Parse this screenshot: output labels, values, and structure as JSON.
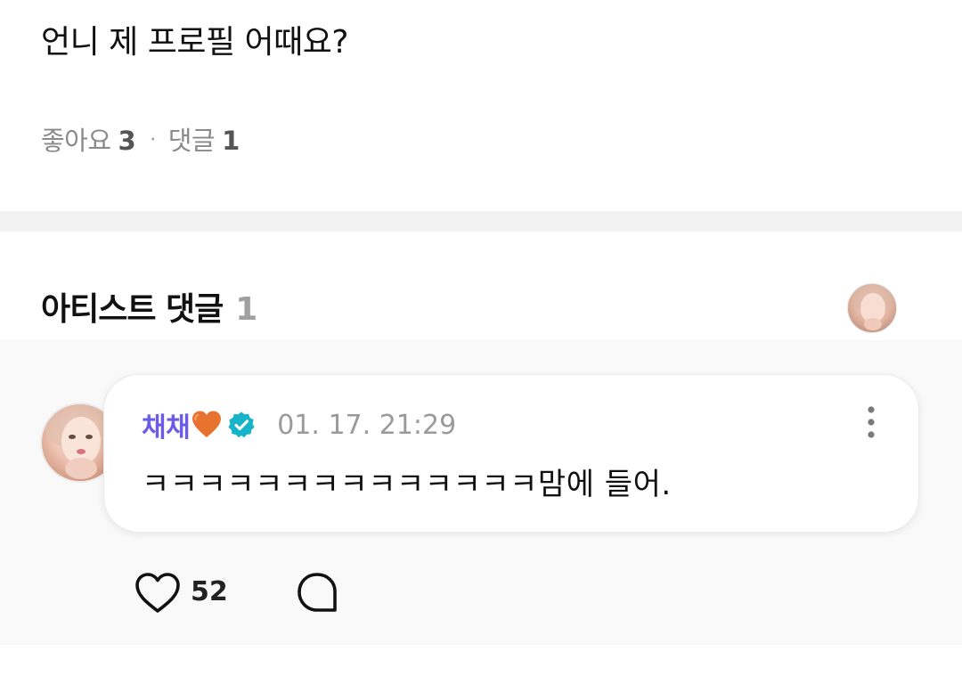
{
  "post": {
    "text": "언니 제 프로필 어때요?",
    "likes_label": "좋아요",
    "likes_count": "3",
    "separator": "·",
    "comments_label": "댓글",
    "comments_count": "1"
  },
  "artist_comments": {
    "title": "아티스트 댓글",
    "count": "1",
    "header_avatar_icon": "artist-avatar"
  },
  "comment": {
    "author": "채채",
    "author_emoji": "orange-heart-icon",
    "verified_icon": "verified-badge-icon",
    "timestamp": "01. 17. 21:29",
    "text": "ㅋㅋㅋㅋㅋㅋㅋㅋㅋㅋㅋㅋㅋㅋ맘에 들어.",
    "like_count": "52",
    "more_icon": "more-vertical-icon",
    "like_icon": "heart-outline-icon",
    "reply_icon": "speech-bubble-icon"
  },
  "colors": {
    "author_name": "#6a5ce6",
    "verified_badge": "#17b3c9",
    "heart_emoji": "#e8732e",
    "muted_text": "#8a8a8a",
    "divider": "#f2f2f2",
    "comment_area_bg": "#f9f9f9"
  }
}
